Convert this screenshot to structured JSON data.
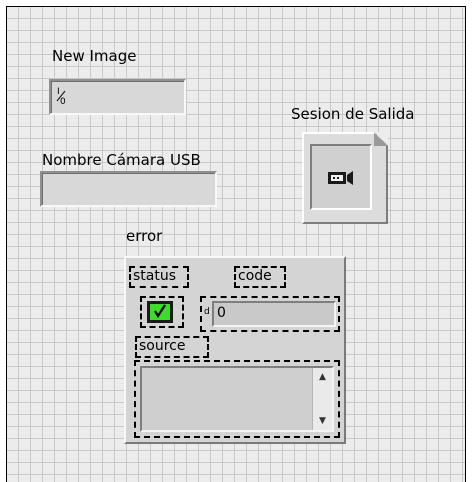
{
  "new_image": {
    "label": "New Image",
    "path_glyph": "⅟₀"
  },
  "camera": {
    "label": "Nombre Cámara USB",
    "value": ""
  },
  "session": {
    "label": "Sesion de Salida",
    "icon": "camera-icon"
  },
  "error_cluster": {
    "label": "error",
    "status_label": "status",
    "code_label": "code",
    "source_label": "source",
    "status_ok": true,
    "code_radix": "d",
    "code_value": "0",
    "source_value": ""
  },
  "colors": {
    "check_green": "#3ddc2c",
    "panel_bg": "#ececec",
    "grid": "#c8c8c8"
  }
}
